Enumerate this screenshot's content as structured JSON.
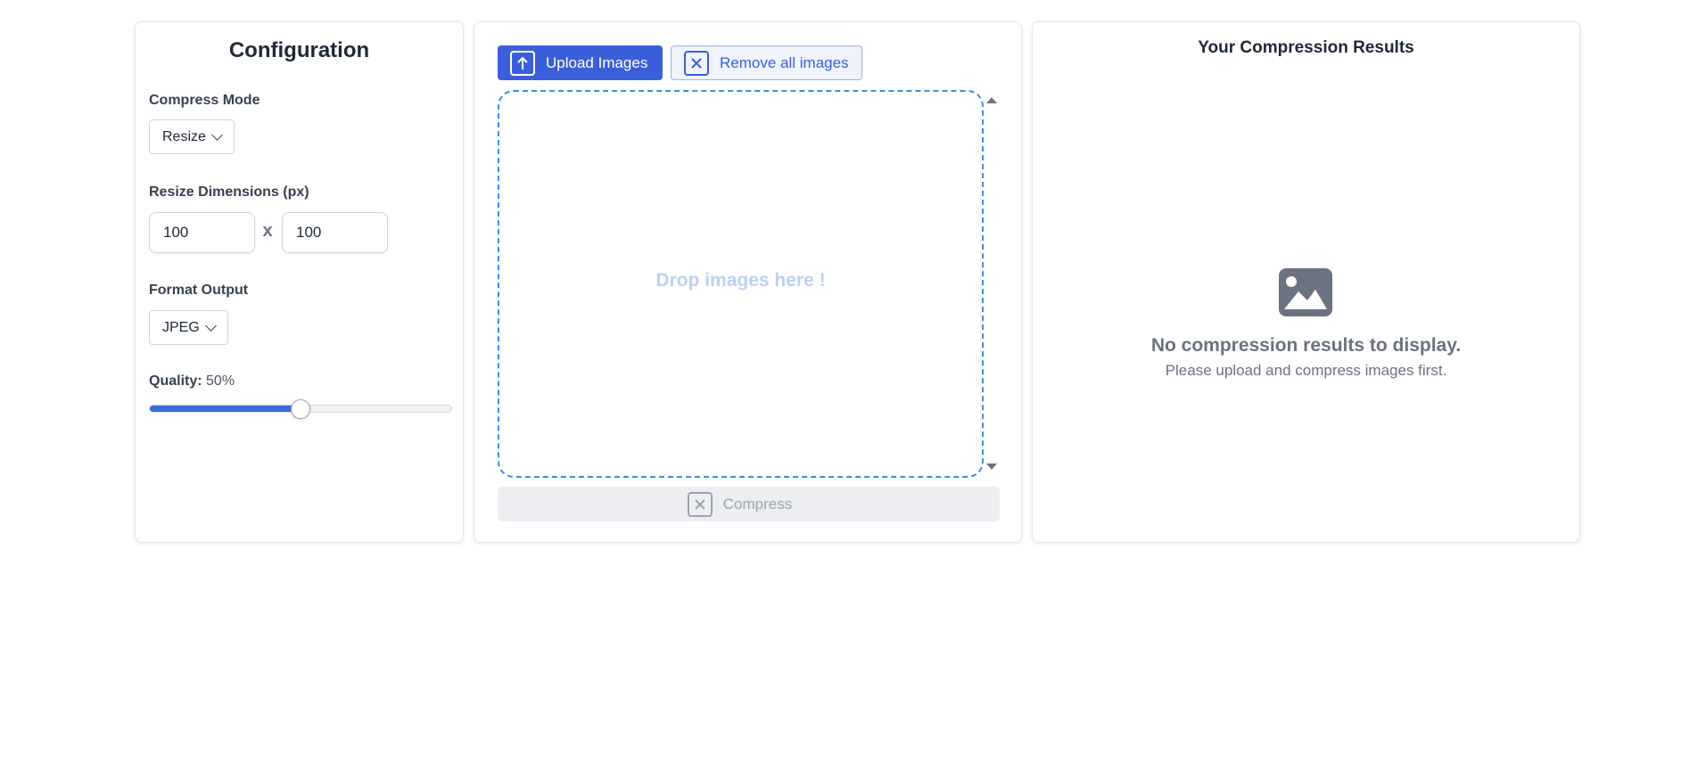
{
  "config": {
    "title": "Configuration",
    "compress_mode": {
      "label": "Compress Mode",
      "selected": "Resize"
    },
    "resize": {
      "label": "Resize Dimensions (px)",
      "width": "100",
      "height": "100",
      "separator": "x"
    },
    "format_output": {
      "label": "Format Output",
      "selected": "JPEG"
    },
    "quality": {
      "label": "Quality:",
      "value_text": "50%",
      "value": 0.5
    }
  },
  "upload": {
    "upload_label": "Upload Images",
    "remove_label": "Remove all images",
    "drop_text": "Drop images here !",
    "compress_label": "Compress"
  },
  "results": {
    "title": "Your Compression Results",
    "empty_title": "No compression results to display.",
    "empty_subtitle": "Please upload and compress images first."
  },
  "colors": {
    "primary": "#3b5fd9",
    "dropzone_border": "#3b8fe0",
    "muted": "#6b7280"
  }
}
